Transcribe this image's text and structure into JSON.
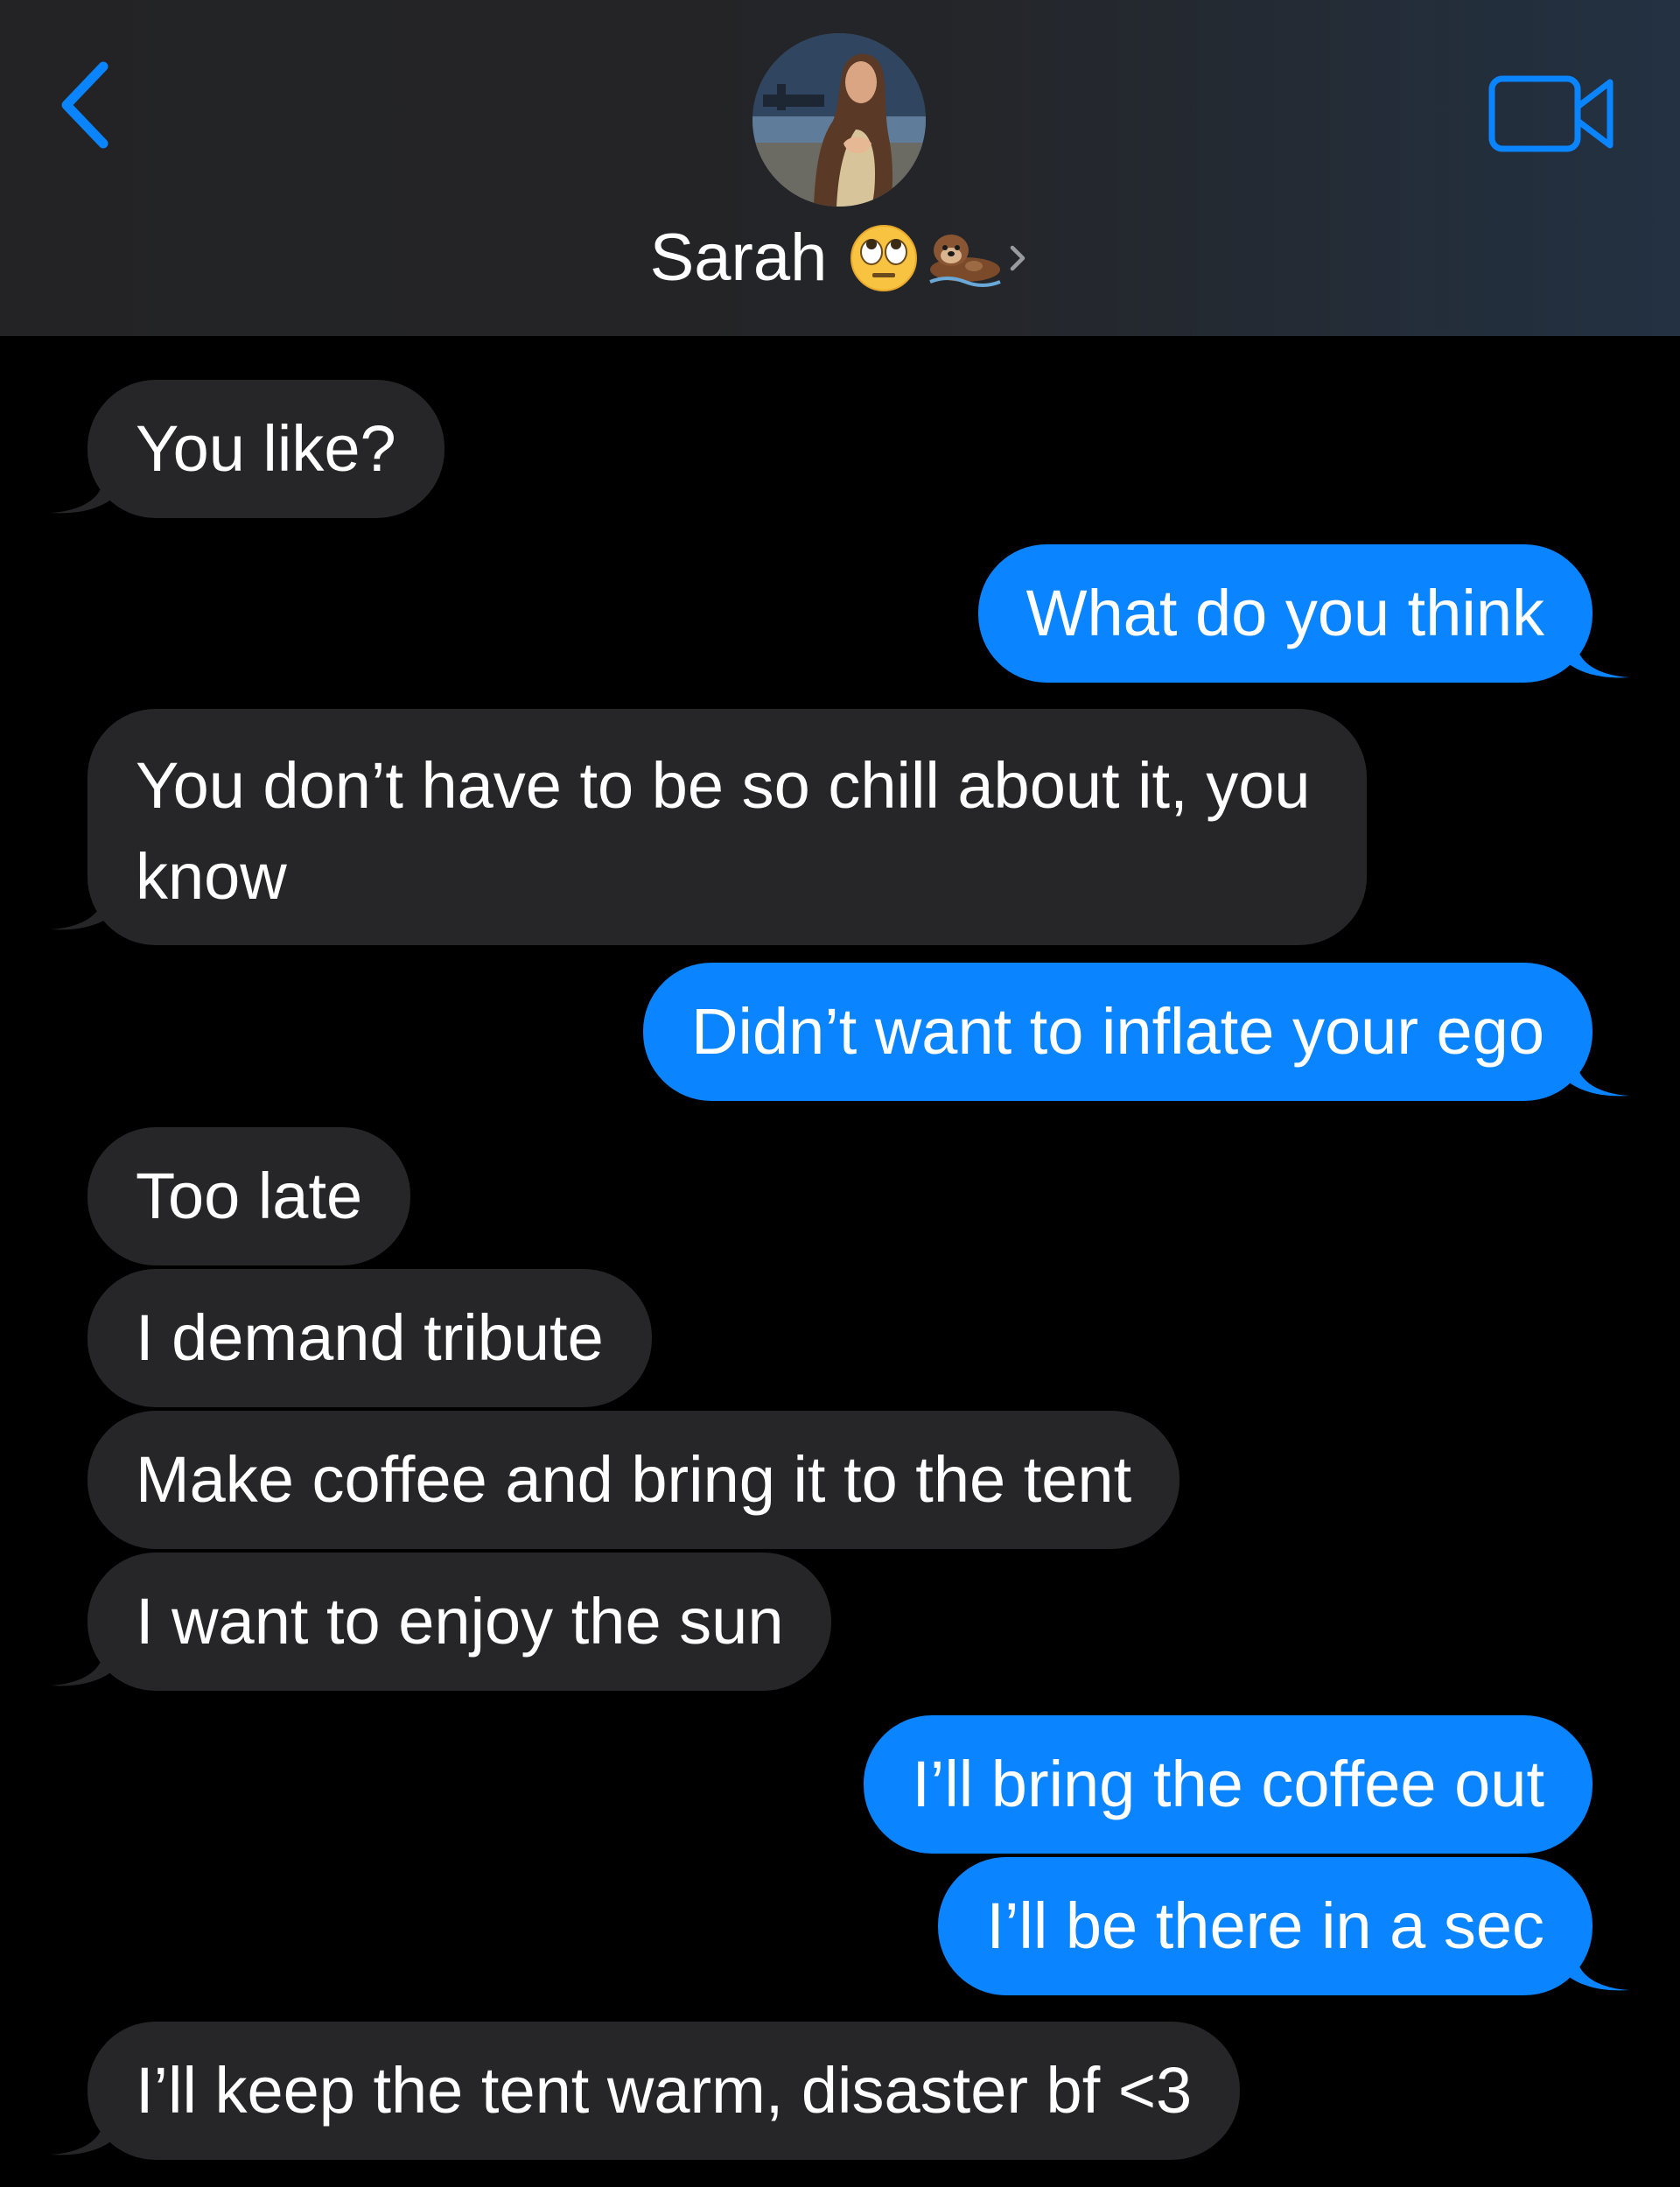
{
  "colors": {
    "sent_bubble": "#0a84ff",
    "received_bubble": "#262628",
    "accent_blue": "#0a84ff",
    "background": "#000000"
  },
  "header": {
    "back_icon": "chevron-left-icon",
    "contact_name": "Sarah",
    "name_emojis": [
      "face-with-rolling-eyes-icon",
      "otter-icon"
    ],
    "details_icon": "chevron-right-icon",
    "video_icon": "video-camera-icon"
  },
  "messages": [
    {
      "sender": "them",
      "text": "You like?"
    },
    {
      "sender": "me",
      "text": "What do you think"
    },
    {
      "sender": "them",
      "text": "You don’t have to be so chill about it, you know"
    },
    {
      "sender": "me",
      "text": "Didn’t want to inflate your ego"
    },
    {
      "sender": "them",
      "text": "Too late"
    },
    {
      "sender": "them",
      "text": "I demand tribute"
    },
    {
      "sender": "them",
      "text": "Make coffee and bring it to the tent"
    },
    {
      "sender": "them",
      "text": "I want to enjoy the sun"
    },
    {
      "sender": "me",
      "text": "I’ll bring the coffee out"
    },
    {
      "sender": "me",
      "text": "I’ll be there in a sec"
    },
    {
      "sender": "them",
      "text": "I’ll keep the tent warm, disaster bf <3"
    }
  ]
}
